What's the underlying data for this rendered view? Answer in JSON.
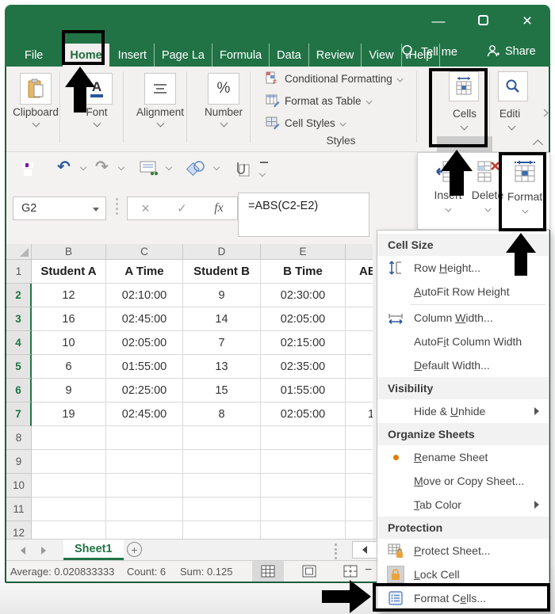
{
  "colors": {
    "excel_green": "#217346",
    "active_tab_text": "#1e6b41",
    "undo_blue": "#2b579a",
    "save_purple": "#7719aa",
    "delete_red": "#c53929",
    "lock_orange": "#e8a33d",
    "highlight_gray": "#cccccc",
    "annotation_black": "#000000"
  },
  "window_controls": {
    "minimize": "—",
    "close": "×"
  },
  "titlebar": {
    "tabs": [
      {
        "label": "File"
      },
      {
        "label": "Home",
        "active": true
      },
      {
        "label": "Insert"
      },
      {
        "label": "Page La"
      },
      {
        "label": "Formula"
      },
      {
        "label": "Data"
      },
      {
        "label": "Review"
      },
      {
        "label": "View"
      },
      {
        "label": "Help"
      }
    ],
    "tell_me": "Tell me",
    "share": "Share"
  },
  "ribbon": {
    "clipboard": "Clipboard",
    "font": "Font",
    "font_icon": "A",
    "alignment": "Alignment",
    "number": "Number",
    "number_icon": "%",
    "styles": {
      "items": [
        "Conditional Formatting",
        "Format as Table",
        "Cell Styles"
      ],
      "label": "Styles"
    },
    "cells": "Cells",
    "editing": "Editi"
  },
  "qat": {
    "undo": "↶",
    "redo": "↷"
  },
  "formula_bar": {
    "name_box": "G2",
    "cancel": "×",
    "enter": "✓",
    "fx_label": "fx",
    "formula": "=ABS(C2-E2)"
  },
  "cells_panel": {
    "insert": "Insert",
    "delete": "Delete",
    "format": "Format"
  },
  "menu": {
    "cell_size": "Cell Size",
    "row_height": {
      "pre": "Row ",
      "key": "H",
      "post": "eight..."
    },
    "autofit_row": {
      "pre": "",
      "key": "A",
      "post": "utoFit Row Height"
    },
    "column_width": {
      "pre": "Column ",
      "key": "W",
      "post": "idth..."
    },
    "autofit_col": {
      "pre": "AutoF",
      "key": "i",
      "post": "t Column Width"
    },
    "default_width": {
      "pre": "",
      "key": "D",
      "post": "efault Width..."
    },
    "visibility": "Visibility",
    "hide_unhide": {
      "pre": "Hide & ",
      "key": "U",
      "post": "nhide"
    },
    "organize": "Organize Sheets",
    "rename": {
      "pre": "",
      "key": "R",
      "post": "ename Sheet"
    },
    "move_copy": {
      "pre": "",
      "key": "M",
      "post": "ove or Copy Sheet..."
    },
    "tab_color": {
      "pre": "",
      "key": "T",
      "post": "ab Color"
    },
    "protection": "Protection",
    "protect_sheet": {
      "pre": "",
      "key": "P",
      "post": "rotect Sheet..."
    },
    "lock_cell": {
      "pre": "",
      "key": "L",
      "post": "ock Cell"
    },
    "format_cells": {
      "pre": "Format C",
      "key": "e",
      "post": "lls..."
    }
  },
  "sheet": {
    "columns": [
      "B",
      "C",
      "D",
      "E"
    ],
    "rows": [
      {
        "n": "1",
        "b": "Student A",
        "c": "A Time",
        "d": "Student B",
        "e": "B Time",
        "f": "ABS"
      },
      {
        "n": "2",
        "b": "12",
        "c": "02:10:00",
        "d": "9",
        "e": "02:30:00",
        "f": ""
      },
      {
        "n": "3",
        "b": "16",
        "c": "02:45:00",
        "d": "14",
        "e": "02:05:00",
        "f": ""
      },
      {
        "n": "4",
        "b": "10",
        "c": "02:05:00",
        "d": "7",
        "e": "02:15:00",
        "f": ""
      },
      {
        "n": "5",
        "b": "6",
        "c": "01:55:00",
        "d": "13",
        "e": "02:35:00",
        "f": ""
      },
      {
        "n": "6",
        "b": "9",
        "c": "02:25:00",
        "d": "15",
        "e": "01:55:00",
        "f": ""
      },
      {
        "n": "7",
        "b": "19",
        "c": "02:45:00",
        "d": "8",
        "e": "02:05:00",
        "f": "1"
      },
      {
        "n": "8"
      },
      {
        "n": "9"
      },
      {
        "n": "10"
      },
      {
        "n": "11"
      },
      {
        "n": "12"
      }
    ]
  },
  "tabbar": {
    "sheet": "Sheet1",
    "add": "+"
  },
  "status": {
    "average": "Average: 0.020833333",
    "count": "Count: 6",
    "sum": "Sum: 0.125"
  }
}
